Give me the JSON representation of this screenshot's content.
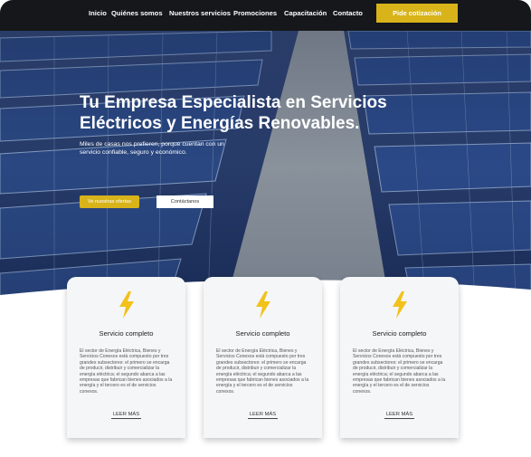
{
  "nav": {
    "items": [
      "Inicio",
      "Quiénes somos",
      "Nuestros servicios",
      "Promociones",
      "Capacitación",
      "Contacto"
    ],
    "cta": "Pide cotización"
  },
  "hero": {
    "title": "Tu Empresa Especialista en Servicios Eléctricos y Energías Renovables.",
    "subtitle": "Miles de casas nos prefieren, porque cuentan con un servicio confiable, seguro y económico.",
    "primary_button": "Ve nuestras ofertas",
    "secondary_button": "Contáctanos"
  },
  "cards": [
    {
      "icon": "lightning-bolt-icon",
      "title": "Servicio completo",
      "text": "El sector de Energía Eléctrica, Bienes y Servicios Conexos está compuesto por tres grandes subsectores: el primero se encarga de producir, distribuir y comercializar la energía eléctrica; el segundo abarca a las empresas que fabrican bienes asociados a la energía y el tercero es el de servicios conexos.",
      "link": "LEER MÁS"
    },
    {
      "icon": "lightning-bolt-icon",
      "title": "Servicio completo",
      "text": "El sector de Energía Eléctrica, Bienes y Servicios Conexos está compuesto por tres grandes subsectores: el primero se encarga de producir, distribuir y comercializar la energía eléctrica; el segundo abarca a las empresas que fabrican bienes asociados a la energía y el tercero es el de servicios conexos.",
      "link": "LEER MÁS"
    },
    {
      "icon": "lightning-bolt-icon",
      "title": "Servicio completo",
      "text": "El sector de Energía Eléctrica, Bienes y Servicios Conexos está compuesto por tres grandes subsectores: el primero se encarga de producir, distribuir y comercializar la energía eléctrica; el segundo abarca a las empresas que fabrican bienes asociados a la energía y el tercero es el de servicios conexos.",
      "link": "LEER MÁS"
    }
  ],
  "colors": {
    "accent": "#d8b41a",
    "nav_background": "#15171a",
    "hero_panels": "#2b4378",
    "card_background": "#f5f6f8"
  }
}
